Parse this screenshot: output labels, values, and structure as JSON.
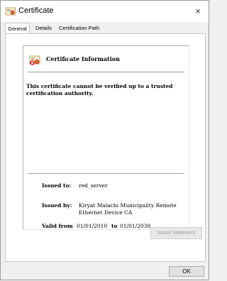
{
  "window": {
    "title": "Certificate",
    "close_label": "×"
  },
  "tabs": [
    {
      "label": "General",
      "active": true
    },
    {
      "label": "Details",
      "active": false
    },
    {
      "label": "Certification Path",
      "active": false
    }
  ],
  "info": {
    "heading": "Certificate Information",
    "warning": "This certificate cannot be verified up to a trusted certification authority.",
    "issued_to_label": "Issued to:",
    "issued_to_value": "red_server",
    "issued_by_label": "Issued by:",
    "issued_by_value": "Kiryat Malachi Municipality Remote Ethernet Device CA",
    "valid_from_label": "Valid from",
    "valid_from_value": "01/01/2010",
    "valid_to_label": "to",
    "valid_to_value": "01/01/2038"
  },
  "buttons": {
    "issuer_statement": "Issuer Statement",
    "ok": "OK"
  },
  "icons": {
    "certificate": "certificate-icon",
    "close": "close-icon"
  },
  "colors": {
    "seal_red": "#c0392b",
    "seal_gold": "#d4a017",
    "x_red": "#e02020"
  }
}
